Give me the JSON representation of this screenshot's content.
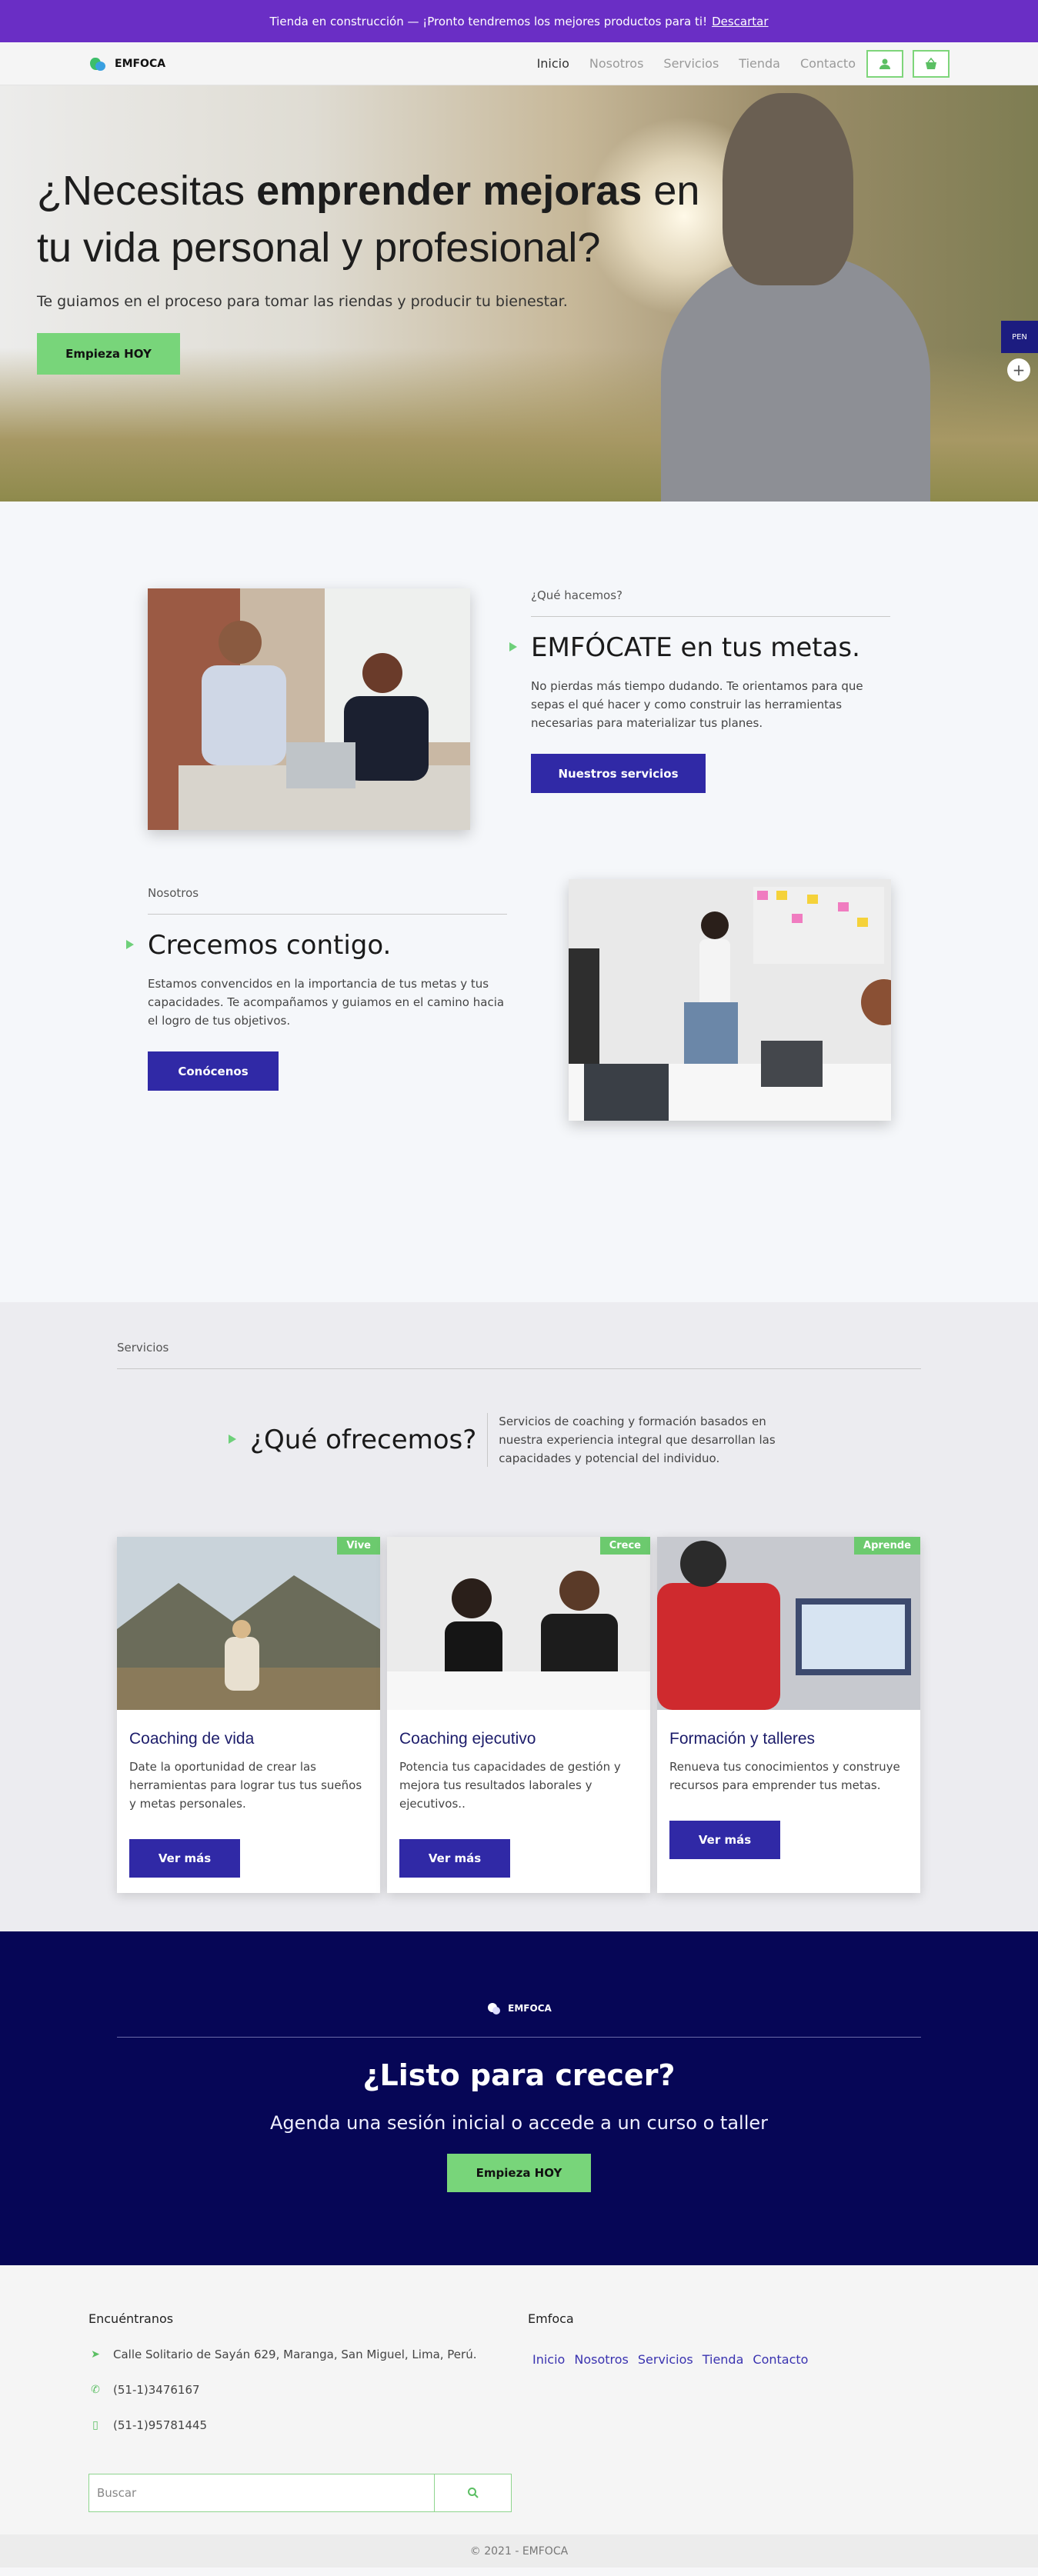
{
  "banner": {
    "text": "Tienda en construcción — ¡Pronto tendremos los mejores productos para ti!",
    "dismiss": "Descartar"
  },
  "brand": {
    "name": "EMFOCA"
  },
  "nav": {
    "items": [
      "Inicio",
      "Nosotros",
      "Servicios",
      "Tienda",
      "Contacto"
    ],
    "active": "Inicio",
    "account_icon": "user-icon",
    "cart_icon": "basket-icon"
  },
  "hero": {
    "title_a": "¿Necesitas ",
    "title_b": "emprender mejoras",
    "title_c": " en tu vida personal y profesional?",
    "subtitle": "Te guiamos en el proceso para tomar las riendas y producir tu bienestar.",
    "cta": "Empieza HOY",
    "side_tab": "PEN",
    "side_plus": "+"
  },
  "about1": {
    "eyebrow": "¿Qué hacemos?",
    "title": "EMFÓCATE en tus metas.",
    "text": "No pierdas más tiempo dudando. Te orientamos para que sepas el qué hacer y como construir las herramientas necesarias para materializar tus planes.",
    "button": "Nuestros servicios"
  },
  "about2": {
    "eyebrow": "Nosotros",
    "title": "Crecemos contigo.",
    "text": "Estamos convencidos en la importancia de tus metas y tus capacidades. Te acompañamos y guiamos en el camino hacia el logro de tus objetivos.",
    "button": "Conócenos"
  },
  "services": {
    "eyebrow": "Servicios",
    "title": "¿Qué ofrecemos?",
    "intro": "Servicios de coaching y formación basados en nuestra experiencia integral que desarrollan las capacidades y potencial del individuo.",
    "cards": [
      {
        "badge": "Vive",
        "title": "Coaching de vida",
        "text": "Date la oportunidad de crear las herramientas para lograr tus tus sueños y metas personales.",
        "button": "Ver más"
      },
      {
        "badge": "Crece",
        "title": "Coaching ejecutivo",
        "text": "Potencia tus capacidades de gestión y mejora tus resultados laborales y ejecutivos..",
        "button": "Ver más"
      },
      {
        "badge": "Aprende",
        "title": "Formación y talleres",
        "text": "Renueva tus conocimientos y construye recursos para emprender tus metas.",
        "button": "Ver más"
      }
    ]
  },
  "cta": {
    "brand": "EMFOCA",
    "title": "¿Listo para crecer?",
    "subtitle": "Agenda una sesión inicial o accede a un curso o taller",
    "button": "Empieza HOY"
  },
  "footer": {
    "left_title": "Encuéntranos",
    "address": "Calle Solitario de Sayán 629, Maranga, San Miguel, Lima, Perú.",
    "phone": "(51-1)3476167",
    "mobile": "(51-1)95781445",
    "search_placeholder": "Buscar",
    "right_title": "Emfoca",
    "links": [
      "Inicio",
      "Nosotros",
      "Servicios",
      "Tienda",
      "Contacto"
    ],
    "copyright": "© 2021 - EMFOCA"
  },
  "colors": {
    "banner": "#6a2ec5",
    "primary_blue": "#3029a6",
    "green": "#78d57a",
    "navy": "#060656"
  }
}
